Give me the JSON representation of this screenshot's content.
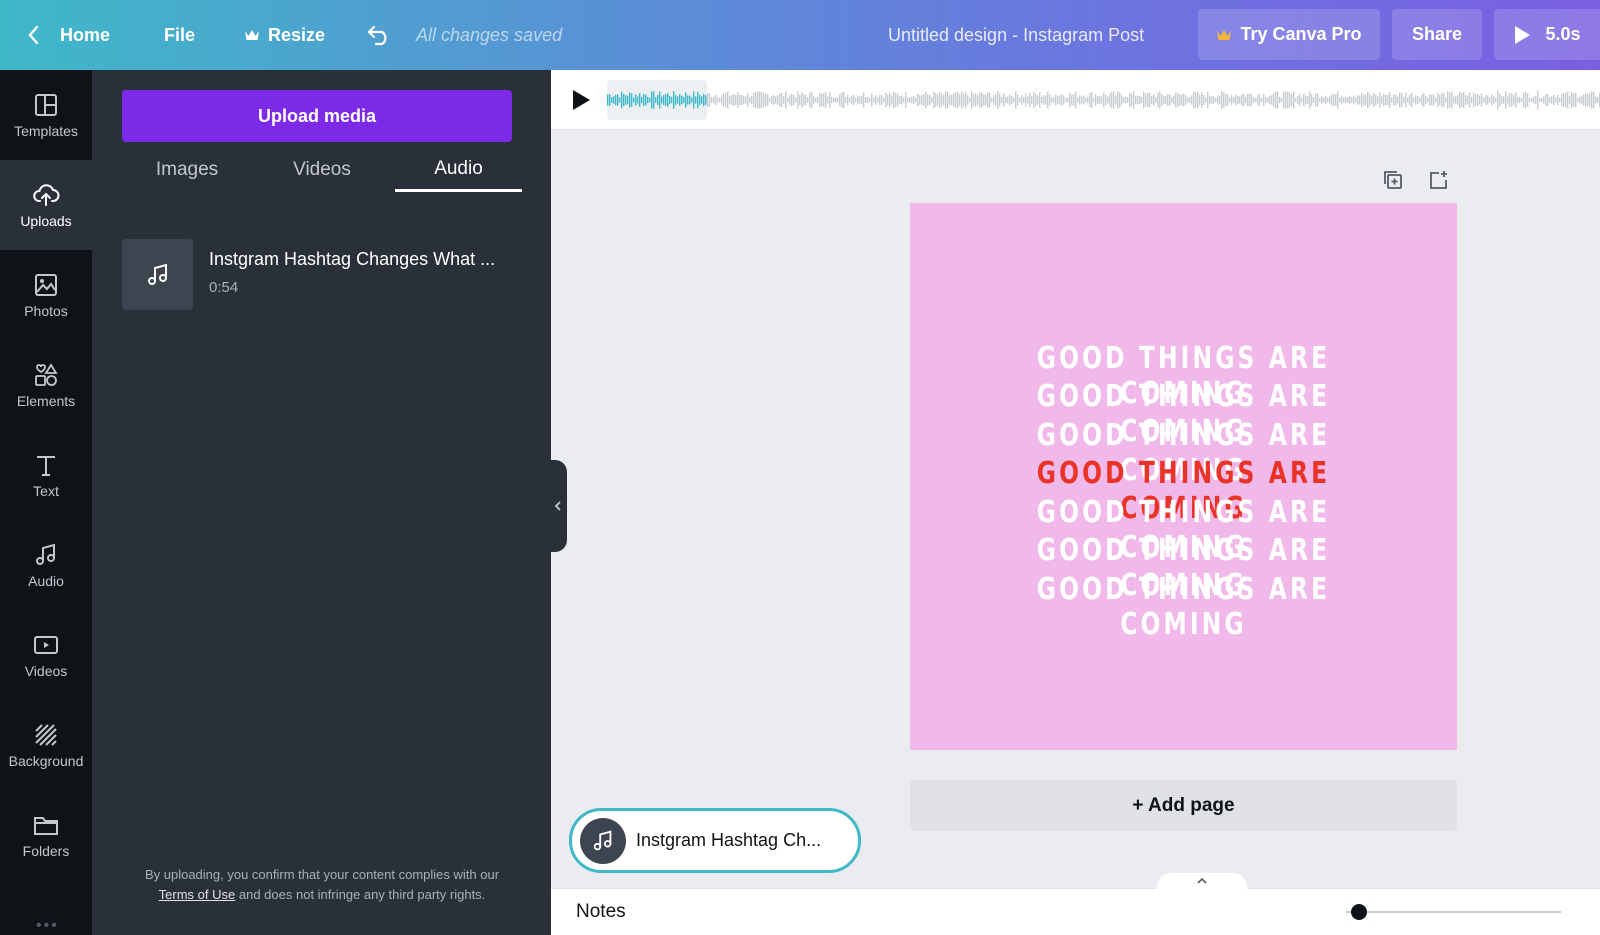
{
  "topbar": {
    "home_label": "Home",
    "file_label": "File",
    "resize_label": "Resize",
    "saved_status": "All changes saved",
    "design_title": "Untitled design - Instagram Post",
    "try_pro_label": "Try Canva Pro",
    "share_label": "Share",
    "duration_label": "5.0s"
  },
  "sidebar": {
    "items": [
      {
        "label": "Templates",
        "icon": "templates-icon"
      },
      {
        "label": "Uploads",
        "icon": "uploads-icon"
      },
      {
        "label": "Photos",
        "icon": "photos-icon"
      },
      {
        "label": "Elements",
        "icon": "elements-icon"
      },
      {
        "label": "Text",
        "icon": "text-icon"
      },
      {
        "label": "Audio",
        "icon": "audio-icon"
      },
      {
        "label": "Videos",
        "icon": "videos-icon"
      },
      {
        "label": "Background",
        "icon": "background-icon"
      },
      {
        "label": "Folders",
        "icon": "folders-icon"
      }
    ],
    "active": "Uploads"
  },
  "panel": {
    "upload_button": "Upload media",
    "tabs": [
      "Images",
      "Videos",
      "Audio"
    ],
    "active_tab": "Audio",
    "audio_items": [
      {
        "name": "Instgram Hashtag Changes What ...",
        "duration": "0:54"
      }
    ],
    "legal_text_1": "By uploading, you confirm that your content complies with our",
    "legal_link": "Terms of Use",
    "legal_text_2": "and does not infringe any third party rights."
  },
  "canvas": {
    "lines": [
      "GOOD THINGS ARE COMING",
      "GOOD THINGS ARE COMING",
      "GOOD THINGS ARE COMING",
      "GOOD THINGS ARE COMING",
      "GOOD THINGS ARE COMING",
      "GOOD THINGS ARE COMING",
      "GOOD THINGS ARE COMING"
    ],
    "highlight_line_index": 3,
    "background_color": "#f1b8ea",
    "text_color": "#ffffff",
    "highlight_color": "#e93327"
  },
  "add_page_label": "+ Add page",
  "audio_pill_label": "Instgram Hashtag Ch...",
  "notes_label": "Notes",
  "colors": {
    "accent_purple": "#7d2ae8",
    "waveform_active": "#3fb8c8",
    "waveform_inactive": "#c9ccd1"
  }
}
